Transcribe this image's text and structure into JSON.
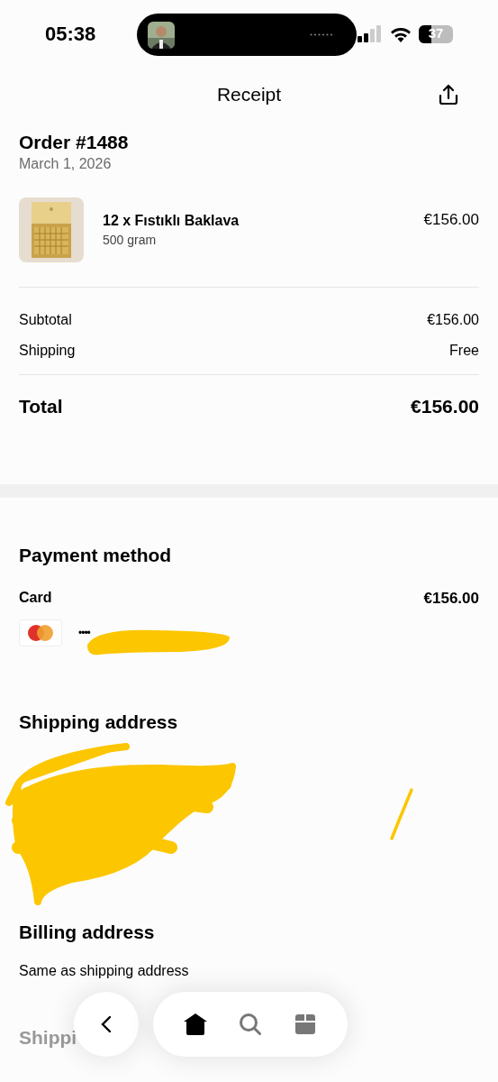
{
  "status_bar": {
    "time": "05:38",
    "battery": "37"
  },
  "header": {
    "title": "Receipt"
  },
  "order": {
    "title": "Order #1488",
    "date": "March 1, 2026"
  },
  "items": [
    {
      "name": "12 x Fıstıklı Baklava",
      "variant": "500 gram",
      "price": "€156.00"
    }
  ],
  "summary": [
    {
      "label": "Subtotal",
      "value": "€156.00"
    },
    {
      "label": "Shipping",
      "value": "Free"
    }
  ],
  "total": {
    "label": "Total",
    "value": "€156.00"
  },
  "payment": {
    "heading": "Payment method",
    "label": "Card",
    "amount": "€156.00",
    "card_number": "••••"
  },
  "shipping_address": {
    "heading": "Shipping address"
  },
  "billing_address": {
    "heading": "Billing address",
    "text": "Same as shipping address"
  },
  "next_section": {
    "heading": "Shippi"
  },
  "nav_items": [
    {
      "kind": "home",
      "selected": true
    },
    {
      "kind": "search",
      "selected": false
    },
    {
      "kind": "box",
      "selected": false
    }
  ]
}
